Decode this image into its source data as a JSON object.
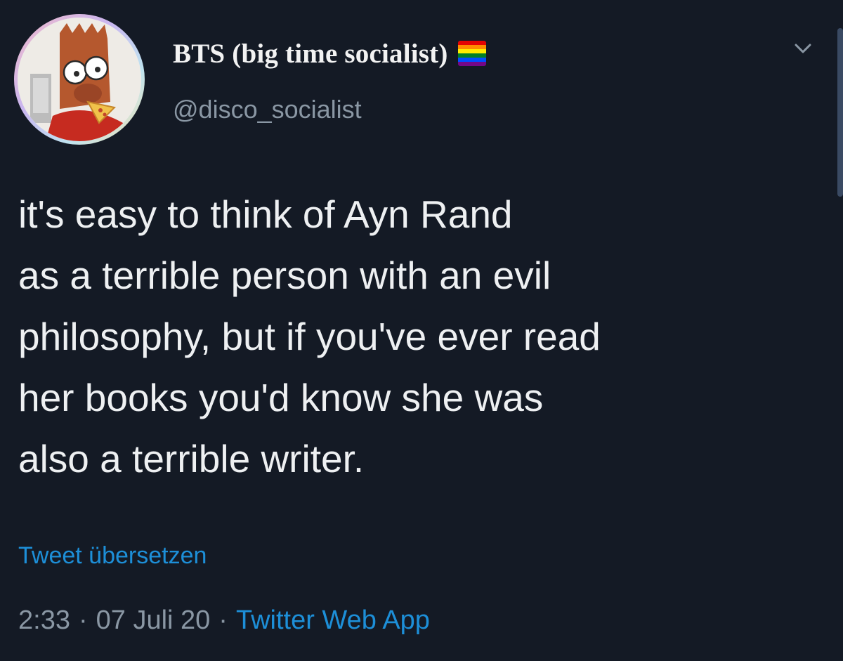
{
  "user": {
    "display_name": "BTS (big time socialist)",
    "handle": "@disco_socialist",
    "avatar_icon": "cartoon-character-avatar",
    "flag_icon": "rainbow-flag",
    "flag_colors": [
      "#e40303",
      "#ff8c00",
      "#ffed00",
      "#008026",
      "#004dff",
      "#750787"
    ]
  },
  "tweet": {
    "text": "it's easy to think of Ayn Rand\nas a terrible person with an evil\nphilosophy, but if you've ever read\nher books you'd know she was\nalso a terrible writer.",
    "translate_label": "Tweet übersetzen",
    "time": "2:33",
    "date": "07 Juli 20",
    "separator": "·",
    "source": "Twitter Web App"
  },
  "menu": {
    "icon": "chevron-down-icon"
  },
  "colors": {
    "background": "#141a25",
    "text": "#eef0f2",
    "muted": "#8a97a4",
    "link": "#1d8fd8"
  }
}
